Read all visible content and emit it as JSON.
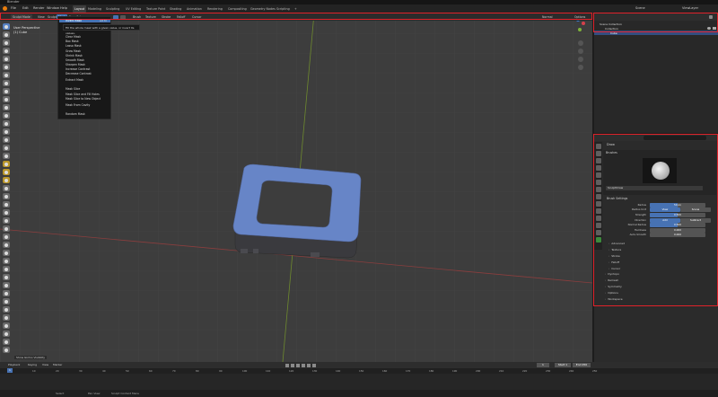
{
  "app": {
    "title": "Blender"
  },
  "menus": [
    "File",
    "Edit",
    "Render",
    "Window",
    "Help"
  ],
  "workspaces": [
    "Layout",
    "Modeling",
    "Sculpting",
    "UV Editing",
    "Texture Paint",
    "Shading",
    "Animation",
    "Rendering",
    "Compositing",
    "Geometry Nodes",
    "Scripting"
  ],
  "active_workspace": "Layout",
  "scene": {
    "scene_name": "Scene",
    "view_layer": "ViewLayer"
  },
  "viewport_header": {
    "mode": "Sculpt Mode",
    "menus": [
      "View",
      "Sculpt",
      "Mask",
      "Face Sets"
    ],
    "right_tools": [
      "Brush",
      "Texture",
      "Stroke",
      "Falloff",
      "Cursor"
    ],
    "orientation": "Normal",
    "options": "Options"
  },
  "viewport": {
    "perspective": "User Perspective",
    "object": "(1) Cube"
  },
  "mask_menu": {
    "items": [
      "Invert Mask",
      "Fill Mask",
      "Clear Mask",
      "Box Mask",
      "Lasso Mask",
      "Grow Mask",
      "Shrink Mask",
      "Smooth Mask",
      "Sharpen Mask",
      "Increase Contrast",
      "Decrease Contrast",
      "Extract Mask",
      "Mask Slice",
      "Mask Slice and Fill Holes",
      "Mask Slice to New Object",
      "Mask From Cavity",
      "Random Mask"
    ],
    "highlighted": "Invert Mask",
    "shortcut": "Alt M",
    "tooltip": "Fill the whole mask with a given value, or invert its values."
  },
  "outliner": {
    "root": "Scene Collection",
    "collection": "Collection",
    "object": "Cube"
  },
  "properties": {
    "search_placeholder": "",
    "brush_name": "Draw",
    "brushes_panel": "Brushes",
    "brush_asset": "SculptDraw",
    "brush_settings_panel": "Brush Settings",
    "rows": [
      {
        "label": "Radius",
        "value": "50 px",
        "fill": 0.5
      },
      {
        "label": "Radius Unit",
        "value": "View",
        "alt": "Scene"
      },
      {
        "label": "Strength",
        "value": "0.500",
        "fill": 0.5
      },
      {
        "label": "Direction",
        "value": "Add",
        "alt": "Subtract"
      },
      {
        "label": "Normal Radius",
        "value": "0.500",
        "fill": 0.5
      },
      {
        "label": "Hardness",
        "value": "0.000",
        "fill": 0.0
      },
      {
        "label": "Auto-Smooth",
        "value": "0.000",
        "fill": 0.0
      }
    ],
    "subpanels": [
      "Advanced",
      "Texture",
      "Stroke",
      "Falloff",
      "Cursor"
    ],
    "panels": [
      "Dyntopo",
      "Remesh",
      "Symmetry",
      "Options",
      "Workspace"
    ]
  },
  "timeline": {
    "menus": [
      "Playback",
      "Keying",
      "View",
      "Marker"
    ],
    "current_frame": "1",
    "start": "Start 1",
    "end": "End 250",
    "ticks": [
      "0",
      "10",
      "20",
      "30",
      "40",
      "50",
      "60",
      "70",
      "80",
      "90",
      "100",
      "110",
      "120",
      "130",
      "140",
      "150",
      "160",
      "170",
      "180",
      "190",
      "200",
      "210",
      "220",
      "230",
      "240",
      "250"
    ]
  },
  "statusbar": {
    "left": "Select",
    "middle": "Pan View",
    "right": "Sculpt Context Menu"
  },
  "overlay_label": "Show Gizmo Visibility",
  "colors": {
    "mesh_top": "#6785c7",
    "mesh_side": "#3a3a3e",
    "accent": "#4772b3",
    "highlight_border": "#e0222a"
  }
}
